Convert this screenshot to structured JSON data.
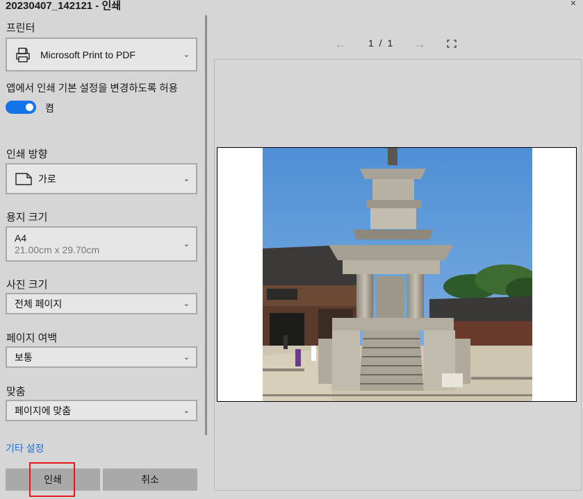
{
  "window": {
    "title": "20230407_142121 - 인쇄",
    "close_glyph": "×"
  },
  "printer": {
    "label": "프린터",
    "value": "Microsoft Print to PDF"
  },
  "app_settings": {
    "label": "앱에서 인쇄 기본 설정을 변경하도록 허용",
    "toggle_state": "켬"
  },
  "orientation": {
    "label": "인쇄 방향",
    "value": "가로"
  },
  "paper_size": {
    "label": "용지 크기",
    "value": "A4",
    "sub": "21.00cm x 29.70cm"
  },
  "photo_size": {
    "label": "사진 크기",
    "value": "전체 페이지"
  },
  "margins": {
    "label": "페이지 여백",
    "value": "보통"
  },
  "fit": {
    "label": "맞춤",
    "value": "페이지에 맞춤"
  },
  "more_settings": "기타 설정",
  "buttons": {
    "print": "인쇄",
    "cancel": "취소"
  },
  "preview": {
    "page_indicator": "1 / 1",
    "prev_glyph": "←",
    "next_glyph": "→"
  },
  "colors": {
    "accent": "#1473e6",
    "link": "#1a6fd1",
    "highlight": "#e8141b"
  },
  "icons": [
    "printer-icon",
    "orientation-page-icon",
    "chevron-down-icon",
    "fit-to-window-icon",
    "close-icon"
  ]
}
